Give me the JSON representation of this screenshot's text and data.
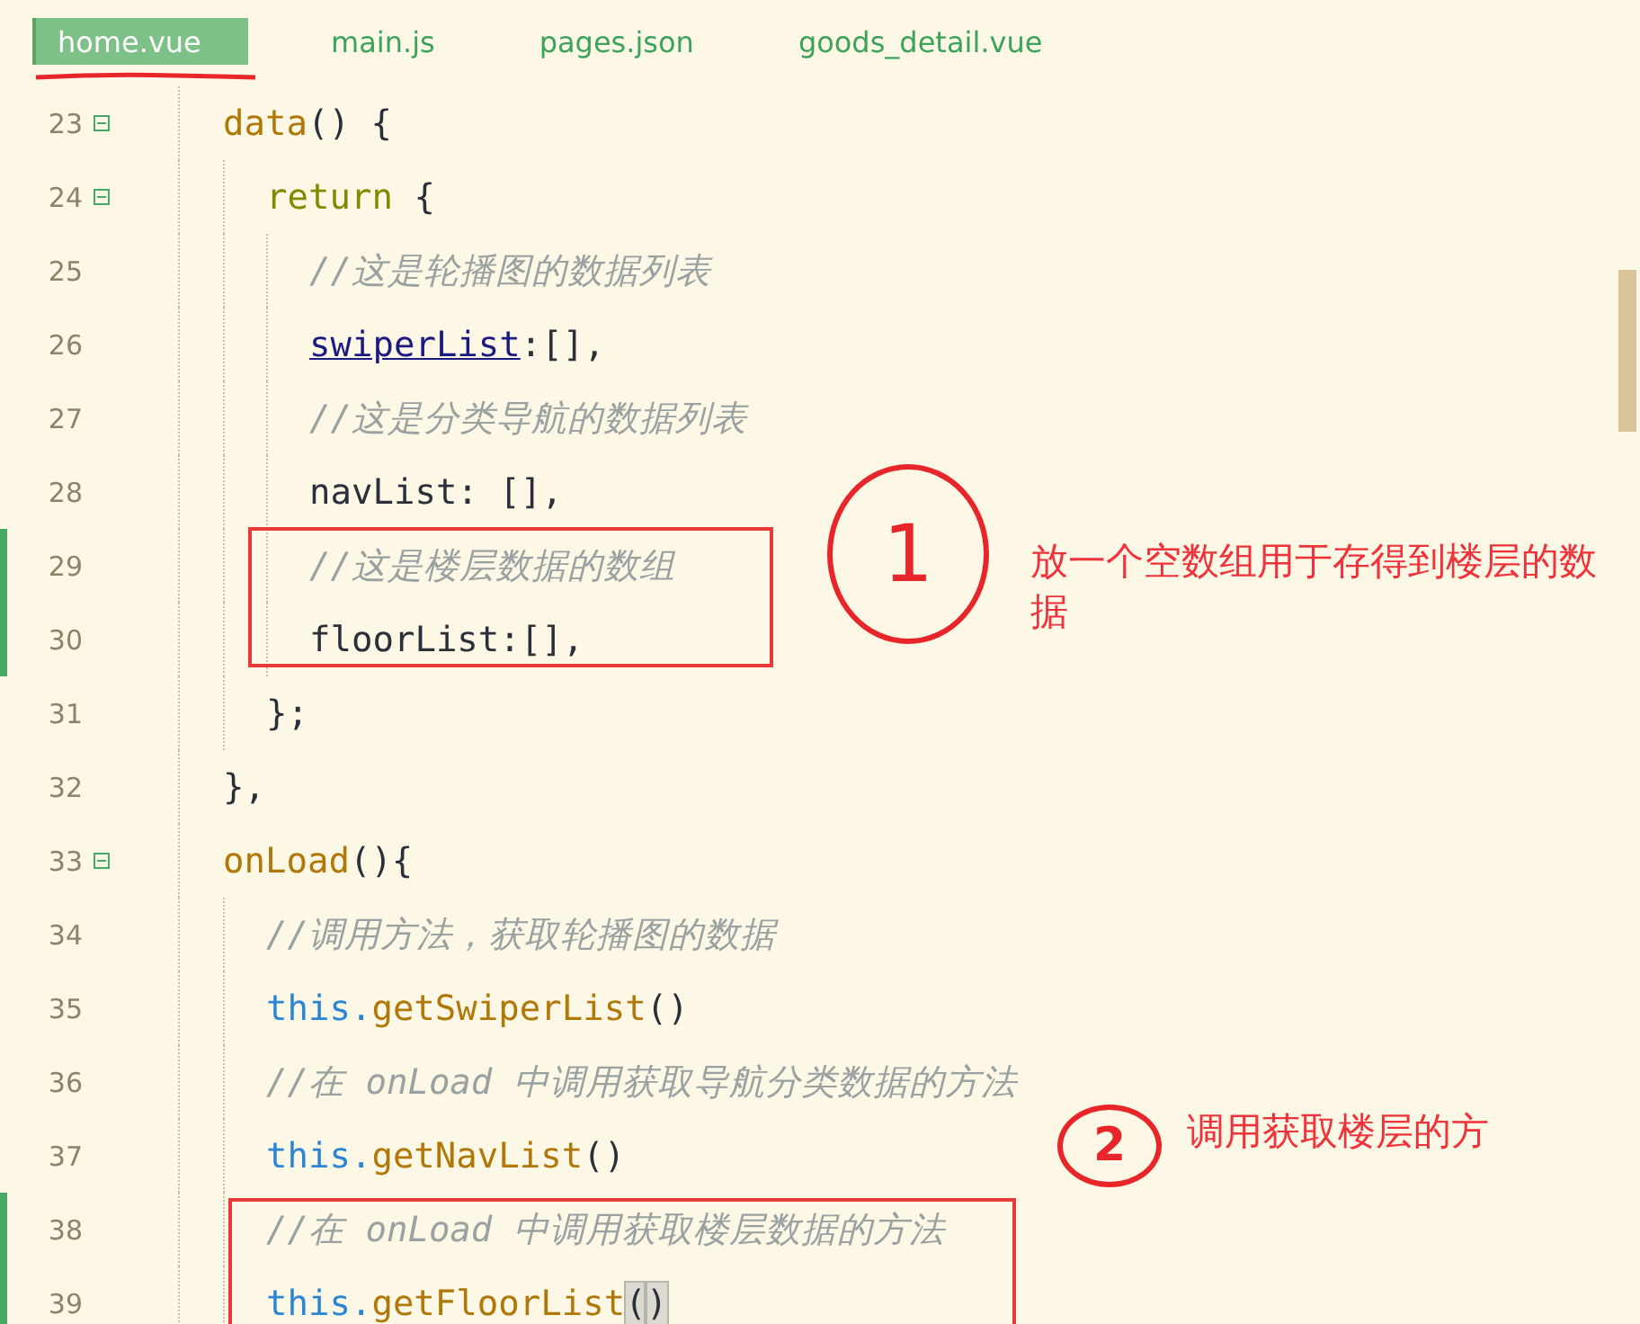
{
  "tabs": [
    {
      "label": "home.vue",
      "selected": true
    },
    {
      "label": "main.js",
      "selected": false
    },
    {
      "label": "pages.json",
      "selected": false
    },
    {
      "label": "goods_detail.vue",
      "selected": false
    }
  ],
  "code": [
    {
      "number": "23",
      "foldable": true,
      "modified": false,
      "tokens": [
        {
          "text": "data",
          "kind": "function"
        },
        {
          "text": "() {",
          "kind": "plain"
        }
      ],
      "children": [
        {
          "number": "24",
          "foldable": true,
          "modified": false,
          "tokens": [
            {
              "text": "return",
              "kind": "keyword"
            },
            {
              "text": " {",
              "kind": "plain"
            }
          ],
          "children": [
            {
              "number": "25",
              "foldable": false,
              "modified": false,
              "tokens": [
                {
                  "text": "//这是轮播图的数据列表",
                  "kind": "comment"
                }
              ]
            },
            {
              "number": "26",
              "foldable": false,
              "modified": false,
              "tokens": [
                {
                  "text": "swiperList",
                  "kind": "underlined"
                },
                {
                  "text": ":[],",
                  "kind": "plain"
                }
              ]
            },
            {
              "number": "27",
              "foldable": false,
              "modified": false,
              "tokens": [
                {
                  "text": "//这是分类导航的数据列表",
                  "kind": "comment"
                }
              ]
            },
            {
              "number": "28",
              "foldable": false,
              "modified": false,
              "tokens": [
                {
                  "text": "navList: [],",
                  "kind": "plain"
                }
              ]
            },
            {
              "number": "29",
              "foldable": false,
              "modified": true,
              "tokens": [
                {
                  "text": "//这是楼层数据的数组",
                  "kind": "comment"
                }
              ]
            },
            {
              "number": "30",
              "foldable": false,
              "modified": true,
              "tokens": [
                {
                  "text": "floorList:[],",
                  "kind": "plain"
                }
              ]
            }
          ]
        },
        {
          "number": "31",
          "foldable": false,
          "modified": false,
          "tokens": [
            {
              "text": "};",
              "kind": "plain"
            }
          ]
        }
      ]
    },
    {
      "number": "32",
      "foldable": false,
      "modified": false,
      "tokens": [
        {
          "text": "},",
          "kind": "plain"
        }
      ]
    },
    {
      "number": "33",
      "foldable": true,
      "modified": false,
      "tokens": [
        {
          "text": "onLoad",
          "kind": "function"
        },
        {
          "text": "(){",
          "kind": "plain"
        }
      ],
      "children": [
        {
          "number": "34",
          "foldable": false,
          "modified": false,
          "tokens": [
            {
              "text": "//调用方法，获取轮播图的数据",
              "kind": "comment"
            }
          ]
        },
        {
          "number": "35",
          "foldable": false,
          "modified": false,
          "tokens": [
            {
              "text": "this.",
              "kind": "self"
            },
            {
              "text": "getSwiperList",
              "kind": "function"
            },
            {
              "text": "()",
              "kind": "plain"
            }
          ]
        },
        {
          "number": "36",
          "foldable": false,
          "modified": false,
          "tokens": [
            {
              "text": "//在 onLoad 中调用获取导航分类数据的方法",
              "kind": "comment"
            }
          ]
        },
        {
          "number": "37",
          "foldable": false,
          "modified": false,
          "tokens": [
            {
              "text": "this.",
              "kind": "self"
            },
            {
              "text": "getNavList",
              "kind": "function"
            },
            {
              "text": "()",
              "kind": "plain"
            }
          ]
        },
        {
          "number": "38",
          "foldable": false,
          "modified": true,
          "tokens": [
            {
              "text": "//在 onLoad 中调用获取楼层数据的方法",
              "kind": "comment"
            }
          ]
        },
        {
          "number": "39",
          "foldable": false,
          "modified": true,
          "tokens": [
            {
              "text": "this.",
              "kind": "self"
            },
            {
              "text": "getFloorList",
              "kind": "function"
            },
            {
              "text": "(",
              "kind": "match"
            },
            {
              "text": ")",
              "kind": "match"
            }
          ]
        }
      ]
    }
  ],
  "annotations": [
    {
      "badge": "1",
      "note": "放一个空数组用于存得到楼层的数据"
    },
    {
      "badge": "2",
      "note": "调用获取楼层的方"
    }
  ]
}
